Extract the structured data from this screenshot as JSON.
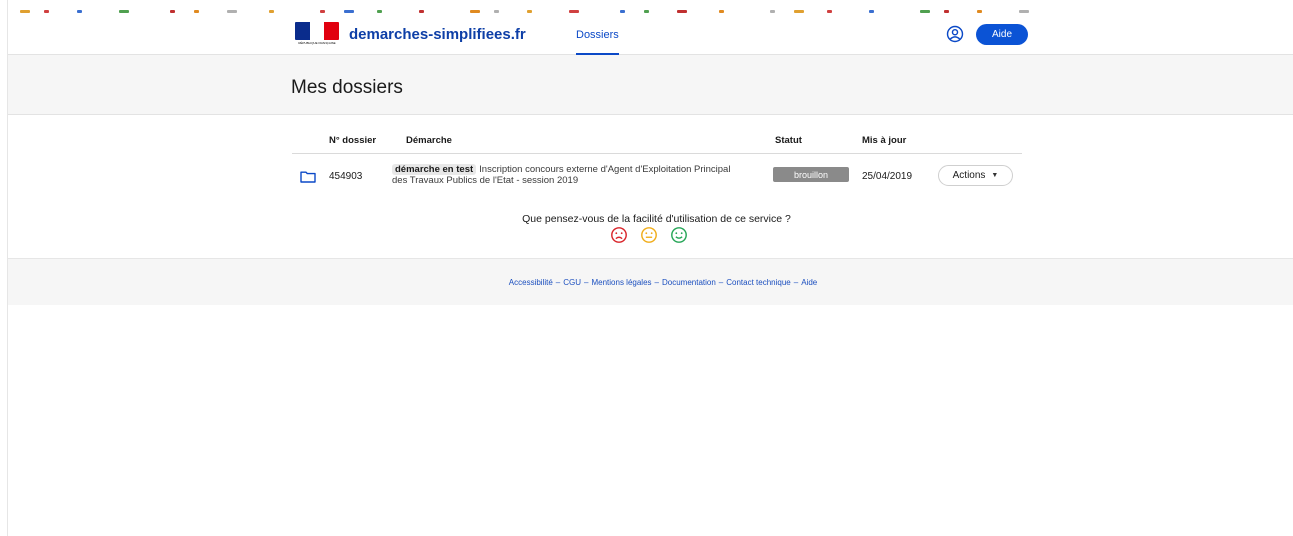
{
  "colors": {
    "brand_blue": "#0e3fa7",
    "accent_blue": "#0b53d5",
    "status_grey": "#8a8a8a",
    "smiley_sad": "#d9252b",
    "smiley_neutral": "#f0ad1b",
    "smiley_happy": "#27a658"
  },
  "header": {
    "logo_caption": "RÉPUBLIQUE FRANÇAISE",
    "site_name": "demarches-simplifiees.fr",
    "nav_tab": "Dossiers",
    "user_icon": "user-circle-icon",
    "help_label": "Aide"
  },
  "page": {
    "title": "Mes dossiers"
  },
  "table": {
    "columns": {
      "number": "N° dossier",
      "procedure": "Démarche",
      "status": "Statut",
      "updated": "Mis à jour"
    },
    "rows": [
      {
        "icon": "folder-icon",
        "number": "454903",
        "tag": "démarche en test",
        "procedure": "Inscription concours externe d'Agent d'Exploitation Principal des Travaux Publics de l'Etat - session 2019",
        "status": "brouillon",
        "updated": "25/04/2019",
        "actions_label": "Actions"
      }
    ]
  },
  "feedback": {
    "question": "Que pensez-vous de la facilité d'utilisation de ce service ?",
    "options": [
      "sad-face-icon",
      "neutral-face-icon",
      "happy-face-icon"
    ]
  },
  "footer": {
    "links": [
      "Accessibilité",
      "CGU",
      "Mentions légales",
      "Documentation",
      "Contact technique",
      "Aide"
    ],
    "separator": "–"
  }
}
